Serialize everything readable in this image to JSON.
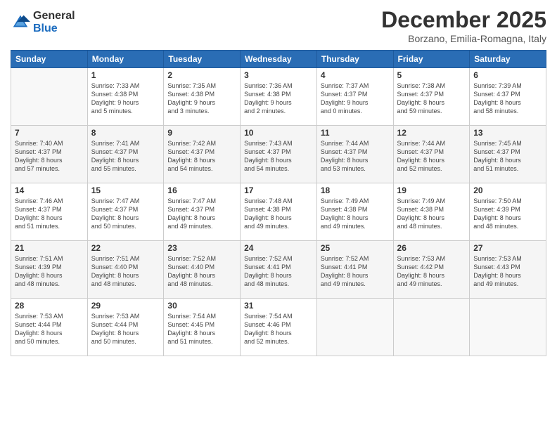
{
  "logo": {
    "general": "General",
    "blue": "Blue"
  },
  "title": "December 2025",
  "location": "Borzano, Emilia-Romagna, Italy",
  "headers": [
    "Sunday",
    "Monday",
    "Tuesday",
    "Wednesday",
    "Thursday",
    "Friday",
    "Saturday"
  ],
  "weeks": [
    [
      {
        "day": "",
        "info": ""
      },
      {
        "day": "1",
        "info": "Sunrise: 7:33 AM\nSunset: 4:38 PM\nDaylight: 9 hours\nand 5 minutes."
      },
      {
        "day": "2",
        "info": "Sunrise: 7:35 AM\nSunset: 4:38 PM\nDaylight: 9 hours\nand 3 minutes."
      },
      {
        "day": "3",
        "info": "Sunrise: 7:36 AM\nSunset: 4:38 PM\nDaylight: 9 hours\nand 2 minutes."
      },
      {
        "day": "4",
        "info": "Sunrise: 7:37 AM\nSunset: 4:37 PM\nDaylight: 9 hours\nand 0 minutes."
      },
      {
        "day": "5",
        "info": "Sunrise: 7:38 AM\nSunset: 4:37 PM\nDaylight: 8 hours\nand 59 minutes."
      },
      {
        "day": "6",
        "info": "Sunrise: 7:39 AM\nSunset: 4:37 PM\nDaylight: 8 hours\nand 58 minutes."
      }
    ],
    [
      {
        "day": "7",
        "info": "Sunrise: 7:40 AM\nSunset: 4:37 PM\nDaylight: 8 hours\nand 57 minutes."
      },
      {
        "day": "8",
        "info": "Sunrise: 7:41 AM\nSunset: 4:37 PM\nDaylight: 8 hours\nand 55 minutes."
      },
      {
        "day": "9",
        "info": "Sunrise: 7:42 AM\nSunset: 4:37 PM\nDaylight: 8 hours\nand 54 minutes."
      },
      {
        "day": "10",
        "info": "Sunrise: 7:43 AM\nSunset: 4:37 PM\nDaylight: 8 hours\nand 54 minutes."
      },
      {
        "day": "11",
        "info": "Sunrise: 7:44 AM\nSunset: 4:37 PM\nDaylight: 8 hours\nand 53 minutes."
      },
      {
        "day": "12",
        "info": "Sunrise: 7:44 AM\nSunset: 4:37 PM\nDaylight: 8 hours\nand 52 minutes."
      },
      {
        "day": "13",
        "info": "Sunrise: 7:45 AM\nSunset: 4:37 PM\nDaylight: 8 hours\nand 51 minutes."
      }
    ],
    [
      {
        "day": "14",
        "info": "Sunrise: 7:46 AM\nSunset: 4:37 PM\nDaylight: 8 hours\nand 51 minutes."
      },
      {
        "day": "15",
        "info": "Sunrise: 7:47 AM\nSunset: 4:37 PM\nDaylight: 8 hours\nand 50 minutes."
      },
      {
        "day": "16",
        "info": "Sunrise: 7:47 AM\nSunset: 4:37 PM\nDaylight: 8 hours\nand 49 minutes."
      },
      {
        "day": "17",
        "info": "Sunrise: 7:48 AM\nSunset: 4:38 PM\nDaylight: 8 hours\nand 49 minutes."
      },
      {
        "day": "18",
        "info": "Sunrise: 7:49 AM\nSunset: 4:38 PM\nDaylight: 8 hours\nand 49 minutes."
      },
      {
        "day": "19",
        "info": "Sunrise: 7:49 AM\nSunset: 4:38 PM\nDaylight: 8 hours\nand 48 minutes."
      },
      {
        "day": "20",
        "info": "Sunrise: 7:50 AM\nSunset: 4:39 PM\nDaylight: 8 hours\nand 48 minutes."
      }
    ],
    [
      {
        "day": "21",
        "info": "Sunrise: 7:51 AM\nSunset: 4:39 PM\nDaylight: 8 hours\nand 48 minutes."
      },
      {
        "day": "22",
        "info": "Sunrise: 7:51 AM\nSunset: 4:40 PM\nDaylight: 8 hours\nand 48 minutes."
      },
      {
        "day": "23",
        "info": "Sunrise: 7:52 AM\nSunset: 4:40 PM\nDaylight: 8 hours\nand 48 minutes."
      },
      {
        "day": "24",
        "info": "Sunrise: 7:52 AM\nSunset: 4:41 PM\nDaylight: 8 hours\nand 48 minutes."
      },
      {
        "day": "25",
        "info": "Sunrise: 7:52 AM\nSunset: 4:41 PM\nDaylight: 8 hours\nand 49 minutes."
      },
      {
        "day": "26",
        "info": "Sunrise: 7:53 AM\nSunset: 4:42 PM\nDaylight: 8 hours\nand 49 minutes."
      },
      {
        "day": "27",
        "info": "Sunrise: 7:53 AM\nSunset: 4:43 PM\nDaylight: 8 hours\nand 49 minutes."
      }
    ],
    [
      {
        "day": "28",
        "info": "Sunrise: 7:53 AM\nSunset: 4:44 PM\nDaylight: 8 hours\nand 50 minutes."
      },
      {
        "day": "29",
        "info": "Sunrise: 7:53 AM\nSunset: 4:44 PM\nDaylight: 8 hours\nand 50 minutes."
      },
      {
        "day": "30",
        "info": "Sunrise: 7:54 AM\nSunset: 4:45 PM\nDaylight: 8 hours\nand 51 minutes."
      },
      {
        "day": "31",
        "info": "Sunrise: 7:54 AM\nSunset: 4:46 PM\nDaylight: 8 hours\nand 52 minutes."
      },
      {
        "day": "",
        "info": ""
      },
      {
        "day": "",
        "info": ""
      },
      {
        "day": "",
        "info": ""
      }
    ]
  ]
}
